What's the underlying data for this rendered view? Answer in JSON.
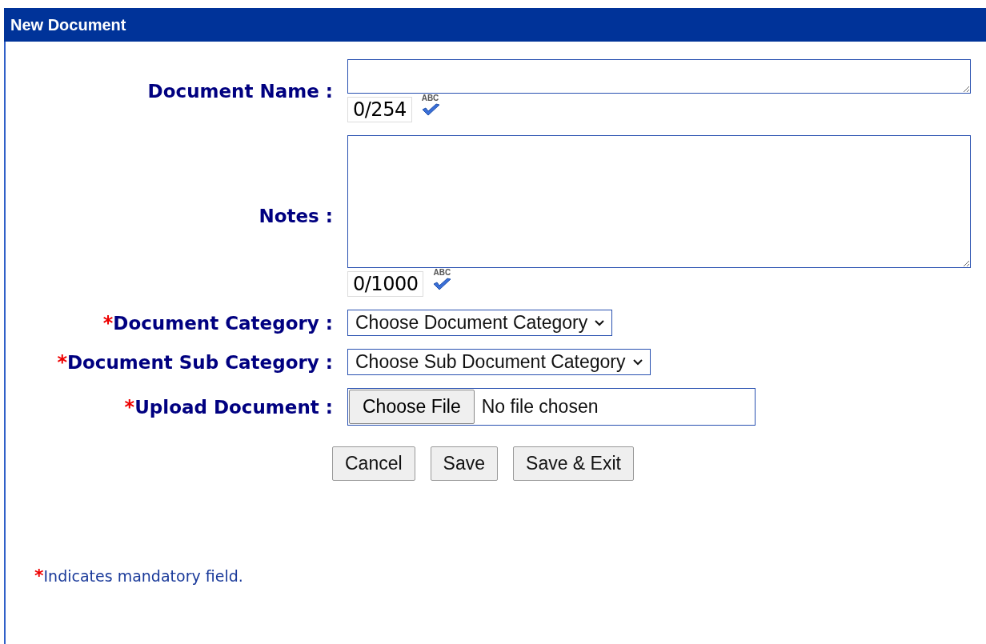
{
  "window": {
    "title": "New Document"
  },
  "fields": [
    {
      "kind": "short-text",
      "label": "Document Name :",
      "counter": "0/254",
      "spellcheck": "ABC"
    },
    {
      "kind": "long-text",
      "label": "Notes :",
      "counter": "0/1000",
      "spellcheck": "ABC"
    },
    {
      "kind": "select",
      "label": "Document Category :",
      "mark": "*",
      "value": "Choose Document Category"
    },
    {
      "kind": "select",
      "label": "Document Sub Category :",
      "mark": "*",
      "value": "Choose Sub Document Category"
    },
    {
      "kind": "file",
      "label": "Upload Document :",
      "mark": "*",
      "button": "Choose File",
      "value": "No file chosen"
    }
  ],
  "buttons": [
    "Cancel",
    "Save",
    "Save & Exit"
  ],
  "footnote": {
    "mark": "*",
    "text": "Indicates mandatory field."
  }
}
